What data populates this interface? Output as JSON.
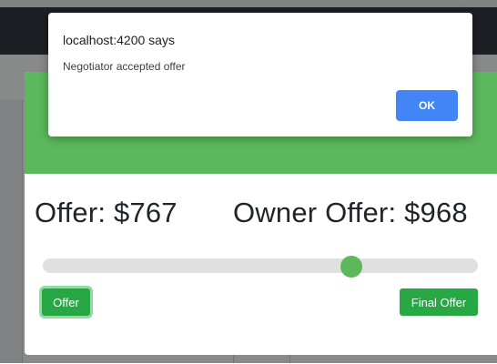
{
  "alert": {
    "title": "localhost:4200 says",
    "message": "Negotiator accepted offer",
    "ok_label": "OK"
  },
  "modal": {
    "offer_text": "Offer: $767",
    "owner_offer_text": "Owner Offer: $968",
    "slider": {
      "position_fraction": 0.71
    },
    "offer_button_label": "Offer",
    "final_offer_button_label": "Final Offer"
  },
  "colors": {
    "header_green": "#5cb85c",
    "button_green": "#28a745",
    "alert_button_blue": "#4285f4"
  }
}
